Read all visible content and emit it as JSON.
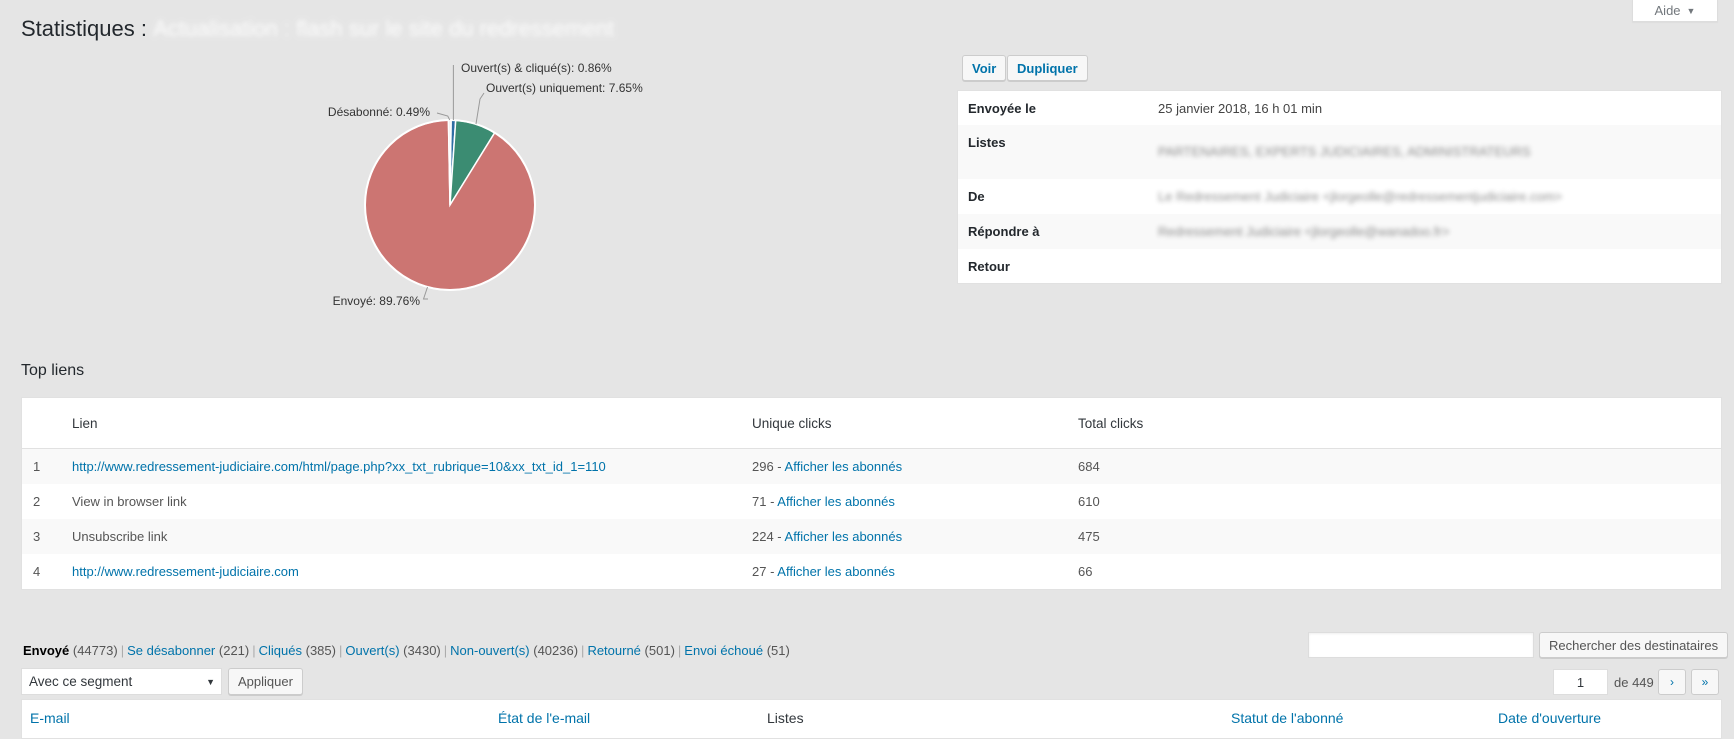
{
  "help": {
    "label": "Aide"
  },
  "page": {
    "title_prefix": "Statistiques :",
    "title_redacted": "Actualisation : flash sur le site du redressement"
  },
  "chart_data": {
    "type": "pie",
    "slices": [
      {
        "label": "Envoyé",
        "value": 89.76,
        "display": "Envoyé: 89.76%",
        "color": "#cc7572"
      },
      {
        "label": "Désabonné",
        "value": 0.49,
        "display": "Désabonné: 0.49%",
        "color": "#f0f0f0"
      },
      {
        "label": "Ouvert(s) & cliqué(s)",
        "value": 0.86,
        "display": "Ouvert(s) & cliqué(s): 0.86%",
        "color": "#2e6da4"
      },
      {
        "label": "Ouvert(s) uniquement",
        "value": 7.65,
        "display": "Ouvert(s) uniquement: 7.65%",
        "color": "#3b8c72"
      }
    ],
    "title": "",
    "legend": "none"
  },
  "actions": {
    "view": "Voir",
    "duplicate": "Dupliquer"
  },
  "details": [
    {
      "key": "Envoyée le",
      "value": "25 janvier 2018, 16 h 01 min",
      "redacted": false
    },
    {
      "key": "Listes",
      "value": "PARTENAIRES, EXPERTS JUDICIAIRES, ADMINISTRATEURS",
      "redacted": true
    },
    {
      "key": "De",
      "value": "Le Redressement Judiciaire <jlorgeolle@redressementjudiciaire.com>",
      "redacted": true
    },
    {
      "key": "Répondre à",
      "value": "Redressement Judiciaire <jlorgeolle@wanadoo.fr>",
      "redacted": true
    },
    {
      "key": "Retour",
      "value": "",
      "redacted": false
    }
  ],
  "top_links": {
    "heading": "Top liens",
    "columns": {
      "num": "",
      "link": "Lien",
      "unique": "Unique clicks",
      "total": "Total clicks"
    },
    "view_subscribers": "Afficher les abonnés",
    "rows": [
      {
        "n": "1",
        "link": "http://www.redressement-judiciaire.com/html/page.php?xx_txt_rubrique=10&xx_txt_id_1=110",
        "is_url": true,
        "unique": "296 - ",
        "total": "684"
      },
      {
        "n": "2",
        "link": "View in browser link",
        "is_url": false,
        "unique": "71 - ",
        "total": "610"
      },
      {
        "n": "3",
        "link": "Unsubscribe link",
        "is_url": false,
        "unique": "224 - ",
        "total": "475"
      },
      {
        "n": "4",
        "link": "http://www.redressement-judiciaire.com",
        "is_url": true,
        "unique": "27 - ",
        "total": "66"
      }
    ]
  },
  "filters": [
    {
      "label": "Envoyé",
      "count": "(44773)",
      "current": true
    },
    {
      "label": "Se désabonner",
      "count": "(221)",
      "current": false
    },
    {
      "label": "Cliqués",
      "count": "(385)",
      "current": false
    },
    {
      "label": "Ouvert(s)",
      "count": "(3430)",
      "current": false
    },
    {
      "label": "Non-ouvert(s)",
      "count": "(40236)",
      "current": false
    },
    {
      "label": "Retourné",
      "count": "(501)",
      "current": false
    },
    {
      "label": "Envoi échoué",
      "count": "(51)",
      "current": false
    }
  ],
  "search": {
    "value": "",
    "button": "Rechercher des destinataires"
  },
  "bulk": {
    "selected": "Avec ce segment",
    "apply": "Appliquer"
  },
  "pagination": {
    "current": "1",
    "of": "de 449",
    "next": "›",
    "last": "»"
  },
  "recipients": {
    "columns": [
      "E-mail",
      "État de l'e-mail",
      "Listes",
      "Statut de l'abonné",
      "Date d'ouverture"
    ]
  },
  "colors": {
    "accent": "#0073aa",
    "sent": "#cc7572",
    "opened": "#3b8c72",
    "clicked": "#2e6da4"
  }
}
